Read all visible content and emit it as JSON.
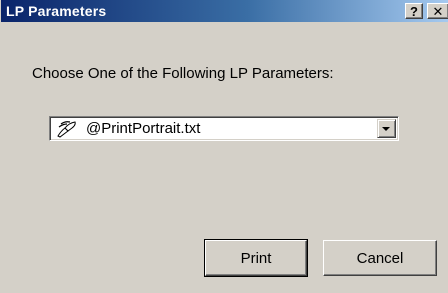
{
  "window": {
    "title": "LP Parameters",
    "help_glyph": "?",
    "close_glyph": "✕"
  },
  "dialog": {
    "prompt": "Choose One of the Following LP Parameters:",
    "selected_parameter": "@PrintPortrait.txt",
    "selected_icon": "lp-parameter-icon"
  },
  "buttons": {
    "print_label": "Print",
    "cancel_label": "Cancel"
  },
  "colors": {
    "titlebar_start": "#0a246a",
    "titlebar_end": "#a6caf0",
    "dialog_face": "#d4d0c8"
  }
}
